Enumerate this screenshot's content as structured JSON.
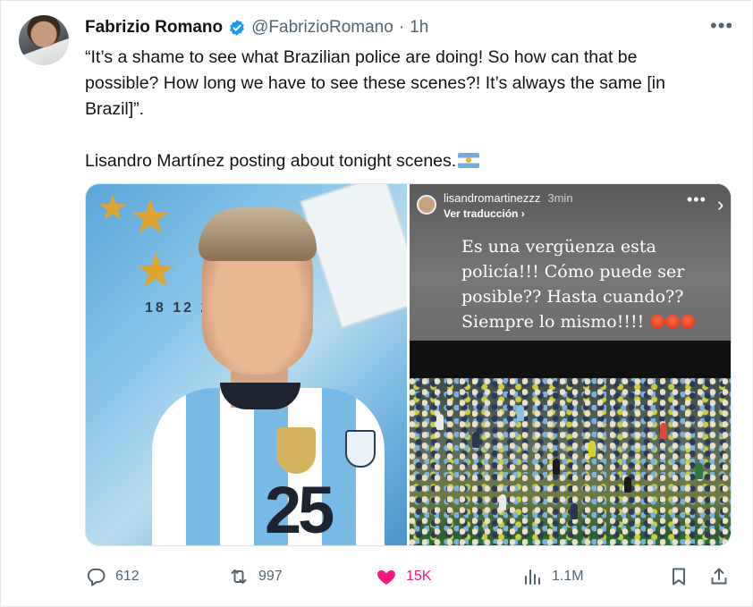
{
  "tweet": {
    "author_name": "Fabrizio Romano",
    "handle": "@FabrizioRomano",
    "separator": "·",
    "time": "1h",
    "text_line1": "“It’s a shame to see what Brazilian police are doing! So how can that be",
    "text_line2": "possible? How long we have to see these scenes?! It’s always the same [in",
    "text_line3": "Brazil]”.",
    "text_line4": "Lisandro Martínez posting about tonight scenes.",
    "flag_icon": "argentina-flag-icon"
  },
  "media": {
    "left_image": {
      "wall_text": "18 12 2",
      "jersey_number": "25"
    },
    "story": {
      "username": "lisandromartinezzz",
      "time": "3min",
      "translate": "Ver traducción ›",
      "text_line1": "Es una vergüenza esta",
      "text_line2": "policía!!! Cómo puede ser",
      "text_line3": "posible?? Hasta cuando??",
      "text_line4": "Siempre lo mismo!!!!"
    }
  },
  "actions": {
    "replies": "612",
    "reposts": "997",
    "likes": "15K",
    "views": "1.1M"
  },
  "colors": {
    "text": "#0f1419",
    "secondary": "#536471",
    "like": "#f91880",
    "verified": "#1d9bf0"
  }
}
